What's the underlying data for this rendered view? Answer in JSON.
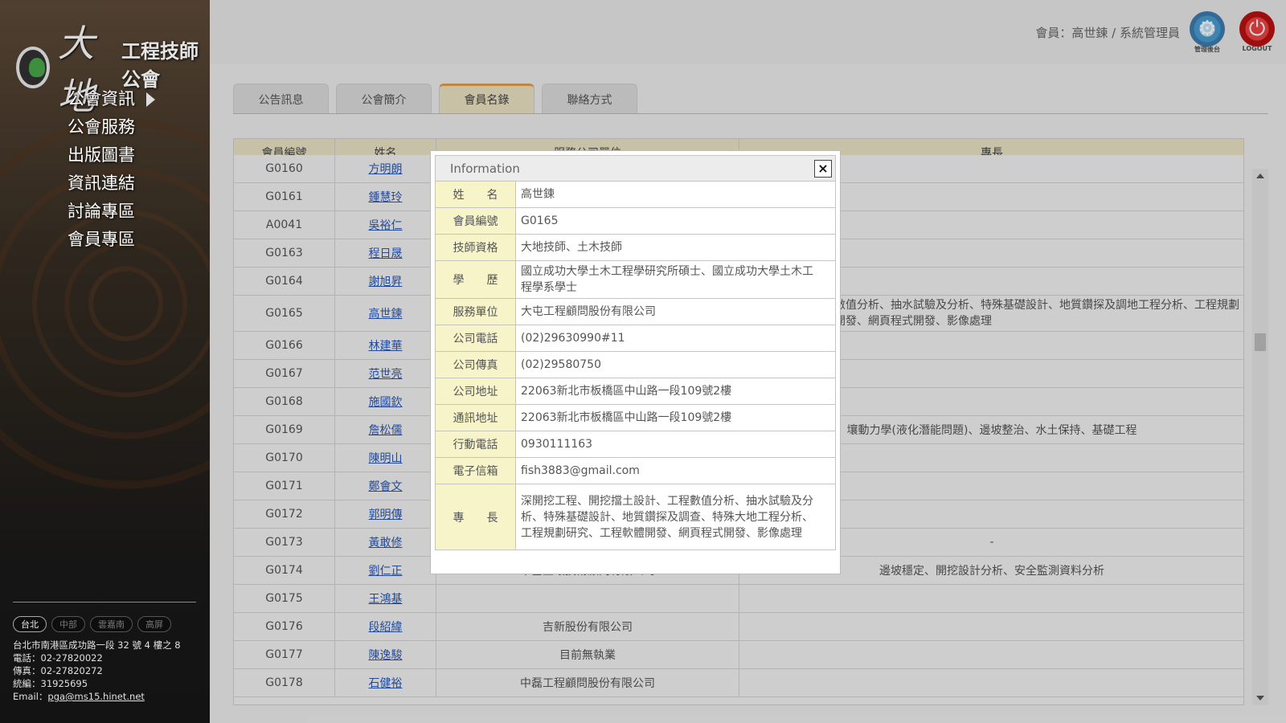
{
  "logo": {
    "mark": "大地",
    "subtitle": "工程技師公會"
  },
  "sidebar": {
    "nav": [
      "公會資訊",
      "公會服務",
      "出版圖書",
      "資訊連結",
      "討論專區",
      "會員專區"
    ],
    "branches": [
      "台北",
      "中部",
      "雲嘉南",
      "高屏"
    ],
    "contact": {
      "address": "台北市南港區成功路一段 32 號 4 樓之 8",
      "phone": "電話：02-27820022",
      "fax": "傳真：02-27820272",
      "tax_id": "統編：31925695",
      "email_label": "Email：",
      "email": "pga@ms15.hinet.net"
    }
  },
  "header": {
    "member_info": "會員：高世鍊 / 系統管理員",
    "admin_caption": "管理後台",
    "logout_caption": "LOGOUT"
  },
  "tabs": [
    "公告訊息",
    "公會簡介",
    "會員名錄",
    "聯絡方式"
  ],
  "table": {
    "headers": [
      "會員編號",
      "姓名",
      "服務公司單位",
      "專長"
    ],
    "rows": [
      {
        "id": "G0160",
        "name": "方明朗",
        "company": "",
        "spec": ""
      },
      {
        "id": "G0161",
        "name": "鍾慧玲",
        "company": "",
        "spec": ""
      },
      {
        "id": "A0041",
        "name": "吳裕仁",
        "company": "",
        "spec": ""
      },
      {
        "id": "G0163",
        "name": "程日晟",
        "company": "",
        "spec": ""
      },
      {
        "id": "G0164",
        "name": "謝旭昇",
        "company": "",
        "spec": ""
      },
      {
        "id": "G0165",
        "name": "高世鍊",
        "company": "",
        "spec": "擋土設計、工程數值分析、抽水試驗及分析、特殊基礎設計、地質鑽探及調地工程分析、工程規劃研究、工程軟體開發、網頁程式開發、影像處理"
      },
      {
        "id": "G0166",
        "name": "林建華",
        "company": "",
        "spec": ""
      },
      {
        "id": "G0167",
        "name": "范世亮",
        "company": "",
        "spec": ""
      },
      {
        "id": "G0168",
        "name": "施國欽",
        "company": "",
        "spec": ""
      },
      {
        "id": "G0169",
        "name": "詹松儒",
        "company": "",
        "spec": "壤動力學(液化潛能問題)、邊坡整治、水土保持、基礎工程"
      },
      {
        "id": "G0170",
        "name": "陳明山",
        "company": "",
        "spec": ""
      },
      {
        "id": "G0171",
        "name": "鄭會文",
        "company": "",
        "spec": ""
      },
      {
        "id": "G0172",
        "name": "郭明傳",
        "company": "",
        "spec": ""
      },
      {
        "id": "G0173",
        "name": "黃敢修",
        "company": "",
        "spec": "-"
      },
      {
        "id": "G0174",
        "name": "劉仁正",
        "company": "中基土壤技術顧問有限公司",
        "spec": "邊坡穩定、開挖設計分析、安全監測資料分析"
      },
      {
        "id": "G0175",
        "name": "王鴻基",
        "company": "",
        "spec": ""
      },
      {
        "id": "G0176",
        "name": "段紹緯",
        "company": "吉新股份有限公司",
        "spec": ""
      },
      {
        "id": "G0177",
        "name": "陳逸駿",
        "company": "目前無執業",
        "spec": ""
      },
      {
        "id": "G0178",
        "name": "石健裕",
        "company": "中磊工程顧問股份有限公司",
        "spec": ""
      }
    ]
  },
  "modal": {
    "title": "Information",
    "close_icon": "close-icon",
    "fields": [
      {
        "label": "姓　　名",
        "value": "高世鍊"
      },
      {
        "label": "會員編號",
        "value": "G0165"
      },
      {
        "label": "技師資格",
        "value": "大地技師、土木技師"
      },
      {
        "label": "學　　歷",
        "value": "國立成功大學土木工程學研究所碩士、國立成功大學土木工程學系學士"
      },
      {
        "label": "服務單位",
        "value": "大屯工程顧問股份有限公司"
      },
      {
        "label": "公司電話",
        "value": "(02)29630990#11"
      },
      {
        "label": "公司傳真",
        "value": "(02)29580750"
      },
      {
        "label": "公司地址",
        "value": "22063新北市板橋區中山路一段109號2樓"
      },
      {
        "label": "通訊地址",
        "value": "22063新北市板橋區中山路一段109號2樓"
      },
      {
        "label": "行動電話",
        "value": "0930111163"
      },
      {
        "label": "電子信箱",
        "value": "fish3883@gmail.com"
      },
      {
        "label": "專　　長",
        "value": "深開挖工程、開挖擋土設計、工程數值分析、抽水試驗及分析、特殊基礎設計、地質鑽探及調查、特殊大地工程分析、工程規劃研究、工程軟體開發、網頁程式開發、影像處理"
      }
    ]
  },
  "colors": {
    "accent": "#e2a04a",
    "table_header": "#e9e3c5",
    "label_bg": "#f7f4c9",
    "link": "#2a57b5"
  }
}
